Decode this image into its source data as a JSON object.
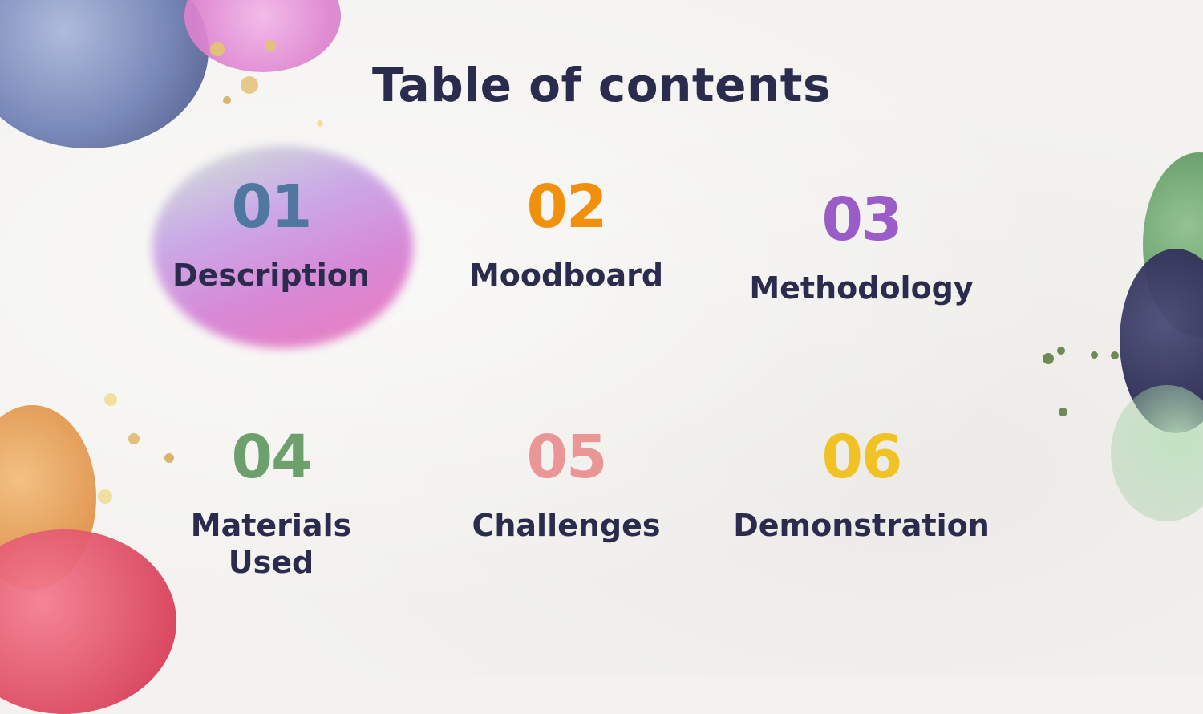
{
  "slide": {
    "title": "Table of contents",
    "colors": {
      "text": "#2a2b4d",
      "background": "#f3f2ef"
    }
  },
  "items": [
    {
      "number": "01",
      "label": "Description",
      "color": "#4f77a0",
      "active": true
    },
    {
      "number": "02",
      "label": "Moodboard",
      "color": "#f0900c",
      "active": false
    },
    {
      "number": "03",
      "label": "Methodology",
      "color": "#9a5cc7",
      "active": false
    },
    {
      "number": "04",
      "label": "Materials Used",
      "color": "#6ea06d",
      "active": false
    },
    {
      "number": "05",
      "label": "Challenges",
      "color": "#ea9697",
      "active": false
    },
    {
      "number": "06",
      "label": "Demonstration",
      "color": "#f0c226",
      "active": false
    }
  ]
}
